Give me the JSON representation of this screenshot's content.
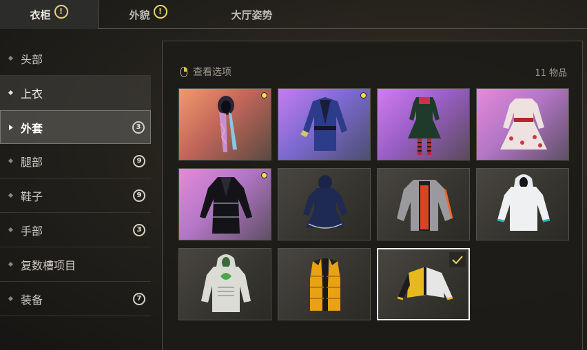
{
  "tabs": [
    {
      "label": "衣柜",
      "warn": "!"
    },
    {
      "label": "外貌",
      "warn": "!"
    },
    {
      "label": "大厅姿势"
    }
  ],
  "sidebar": {
    "items": [
      {
        "label": "头部"
      },
      {
        "label": "上衣"
      },
      {
        "label": "外套",
        "count": "3"
      },
      {
        "label": "腿部",
        "count": "9"
      },
      {
        "label": "鞋子",
        "count": "9"
      },
      {
        "label": "手部",
        "count": "3"
      },
      {
        "label": "复数槽项目"
      },
      {
        "label": "装备",
        "count": "7"
      }
    ]
  },
  "panel": {
    "view_options": "查看选项",
    "item_count": "11 物品"
  },
  "colors": {
    "accent_yellow": "#f0dd55",
    "rarity_purple": "#c67cf0",
    "rarity_orange": "#f09a6c"
  },
  "items": [
    {
      "icon": "hooded-scarf-icon",
      "new": true
    },
    {
      "icon": "blue-jacket-icon",
      "new": true
    },
    {
      "icon": "dark-dress-icon"
    },
    {
      "icon": "white-dress-icon"
    },
    {
      "icon": "black-leather-coat-icon",
      "new": true
    },
    {
      "icon": "navy-hooded-dress-icon"
    },
    {
      "icon": "grey-red-jacket-icon"
    },
    {
      "icon": "white-hoodie-icon"
    },
    {
      "icon": "green-print-hoodie-icon"
    },
    {
      "icon": "yellow-puffer-vest-icon"
    },
    {
      "icon": "yellow-white-jacket-icon",
      "equipped": true
    }
  ]
}
